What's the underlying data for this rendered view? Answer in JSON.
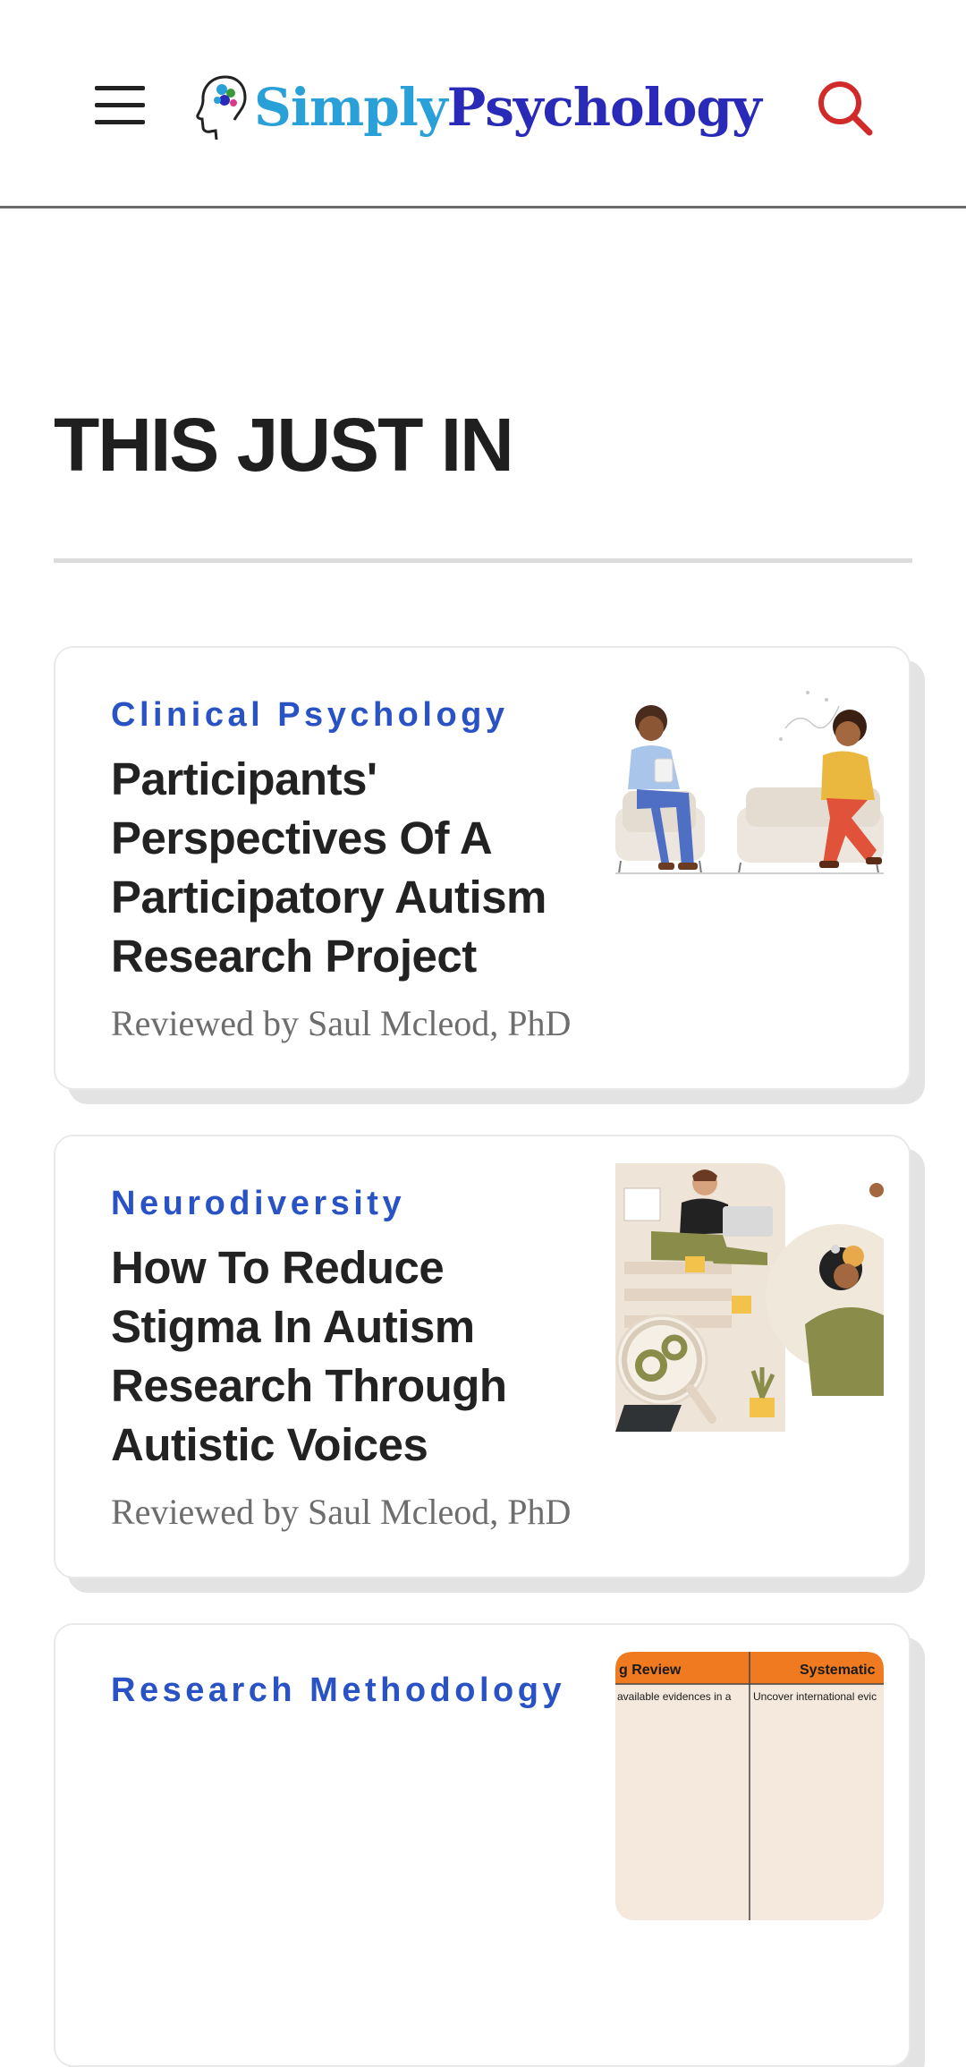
{
  "header": {
    "logo_part1": "Simply",
    "logo_part2": "Psychology",
    "menu_icon": "hamburger-menu-icon",
    "search_icon": "search-icon"
  },
  "section": {
    "title": "THIS JUST IN"
  },
  "articles": [
    {
      "category": "Clinical Psychology",
      "title": "Participants' Perspectives Of A Participatory Autism Research Project",
      "byline": "Reviewed by Saul Mcleod, PhD"
    },
    {
      "category": "Neurodiversity",
      "title": "How To Reduce Stigma In Autism Research Through Autistic Voices",
      "byline": "Reviewed by Saul Mcleod, PhD"
    },
    {
      "category": "Research Methodology",
      "thumb_header_left": "g Review",
      "thumb_header_right": "Systematic",
      "thumb_row_left": "available evidences in a",
      "thumb_row_right": "Uncover international evic"
    }
  ],
  "colors": {
    "category": "#2952c5",
    "logo_simply": "#2aa0d8",
    "logo_psychology": "#2a2ab8",
    "search": "#d12a2a",
    "thumb_orange": "#ef7a20"
  }
}
